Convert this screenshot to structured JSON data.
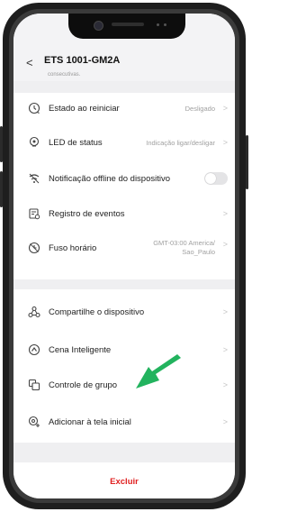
{
  "header": {
    "back_symbol": "<",
    "title": "ETS 1001-GM2A",
    "partial_note": "consecutivas."
  },
  "settings_group_1": [
    {
      "label": "Estado ao reiniciar",
      "value": "Desligado",
      "icon": "restart-icon"
    },
    {
      "label": "LED de status",
      "value": "Indicação ligar/desligar",
      "icon": "led-status-icon"
    },
    {
      "label": "Notificação offline do dispositivo",
      "value": "",
      "icon": "offline-notification-icon",
      "toggle": "off"
    },
    {
      "label": "Registro de eventos",
      "value": "",
      "icon": "event-log-icon"
    },
    {
      "label": "Fuso horário",
      "value_line1": "GMT-03:00 America/",
      "value_line2": "Sao_Paulo",
      "icon": "timezone-icon"
    }
  ],
  "settings_group_2": [
    {
      "label": "Compartilhe o dispositivo",
      "icon": "share-icon"
    },
    {
      "label": "Cena Inteligente",
      "icon": "smart-scene-icon"
    },
    {
      "label": "Controle de grupo",
      "icon": "group-control-icon"
    },
    {
      "label": "Adicionar à tela inicial",
      "icon": "add-home-icon"
    }
  ],
  "footer": {
    "delete_label": "Excluir"
  },
  "colors": {
    "delete": "#e02020",
    "arrow": "#22b35e",
    "background": "#efeff1"
  }
}
